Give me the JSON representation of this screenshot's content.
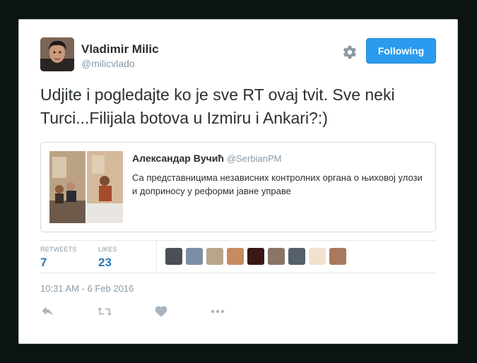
{
  "tweet": {
    "author": {
      "name": "Vladimir Milic",
      "handle": "@milicvlado"
    },
    "follow_label": "Following",
    "text": "Udjite i pogledajte ko je sve RT ovaj tvit. Sve neki Turci...Filijala botova u Izmiru i Ankari?:)",
    "quote": {
      "author_name": "Александар Вучић",
      "author_handle": "@SerbianPM",
      "text": "Са представницима независних контролних органа о њиховој улози и доприносу у реформи јавне управе"
    },
    "stats": {
      "retweets_label": "RETWEETS",
      "retweets_value": "7",
      "likes_label": "LIKES",
      "likes_value": "23"
    },
    "timestamp": "10:31 AM - 6 Feb 2016",
    "actions": [
      "reply-icon",
      "retweet-icon",
      "like-icon",
      "more-icon"
    ]
  },
  "colors": {
    "accent": "#2b9bf0",
    "link": "#2b7bb9",
    "muted": "#8899a6",
    "text": "#292f33",
    "border": "#e1e8ed"
  }
}
